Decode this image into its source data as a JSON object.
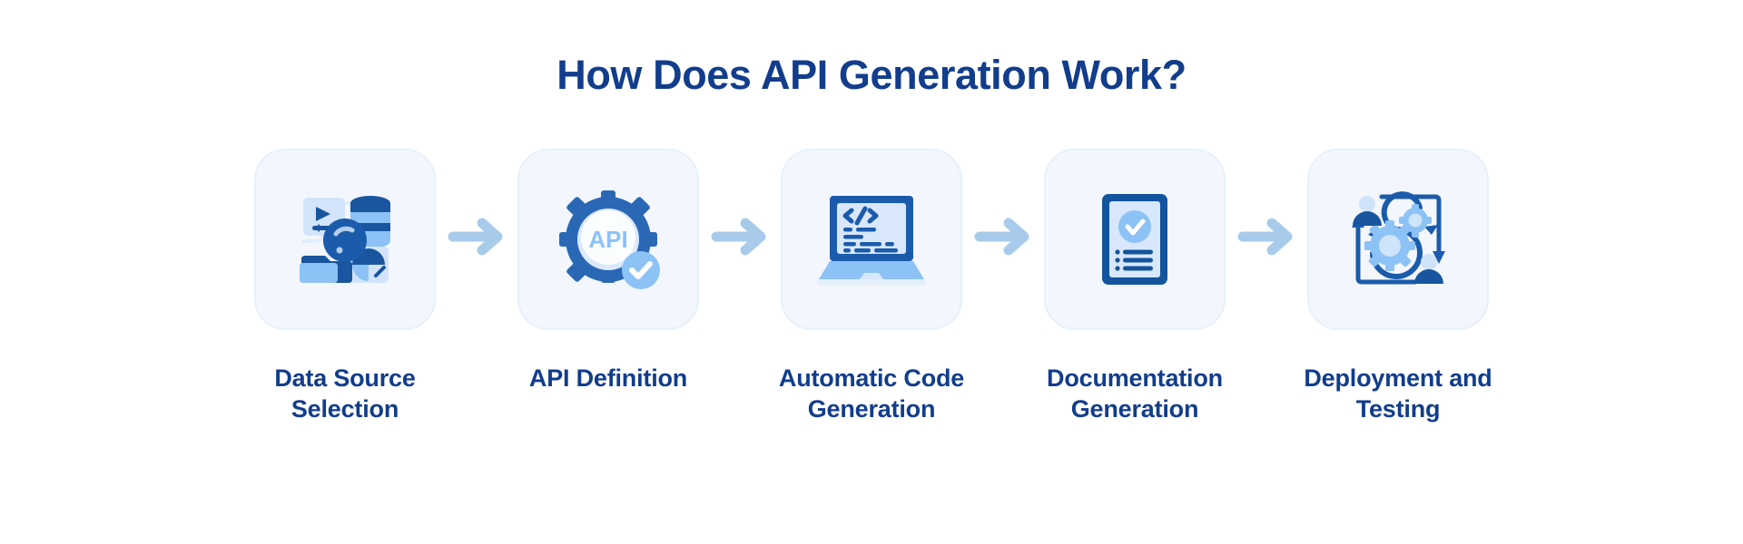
{
  "header": {
    "title": "How Does API Generation Work?"
  },
  "colors": {
    "navy": "#123d8c",
    "icon_dark": "#19569f",
    "icon_mid": "#2d6db8",
    "icon_light": "#8cc2f5",
    "icon_pale": "#d3e4fa",
    "card_bg": "#f3f7fd",
    "card_border": "#e6f1fb",
    "arrow": "#a9cbeb",
    "page_bg": "#ffffff"
  },
  "flow": {
    "steps": [
      {
        "index": 1,
        "label": "Data Source Selection",
        "icon": "data-source-selection-icon",
        "icon_parts": [
          "play-button",
          "database-cylinder",
          "magnifier",
          "folder",
          "pie-chart"
        ]
      },
      {
        "index": 2,
        "label": "API Definition",
        "icon": "api-gear-icon",
        "icon_text": "API",
        "icon_parts": [
          "gear",
          "api-label",
          "check-badge"
        ]
      },
      {
        "index": 3,
        "label": "Automatic Code Generation",
        "icon": "laptop-code-icon",
        "icon_text": "</>",
        "icon_parts": [
          "laptop",
          "code-brackets",
          "code-lines"
        ]
      },
      {
        "index": 4,
        "label": "Documentation Generation",
        "icon": "document-check-icon",
        "icon_parts": [
          "document",
          "check-circle",
          "list-lines"
        ]
      },
      {
        "index": 5,
        "label": "Deployment and Testing",
        "icon": "devops-loop-icon",
        "icon_parts": [
          "infinity-loop",
          "gear-small",
          "gear-large",
          "person-top",
          "person-bottom",
          "cycle-arrows"
        ]
      }
    ],
    "connectors": [
      {
        "index": 1,
        "icon": "arrow-right-icon"
      },
      {
        "index": 2,
        "icon": "arrow-right-icon"
      },
      {
        "index": 3,
        "icon": "arrow-right-icon"
      },
      {
        "index": 4,
        "icon": "arrow-right-icon"
      }
    ]
  }
}
